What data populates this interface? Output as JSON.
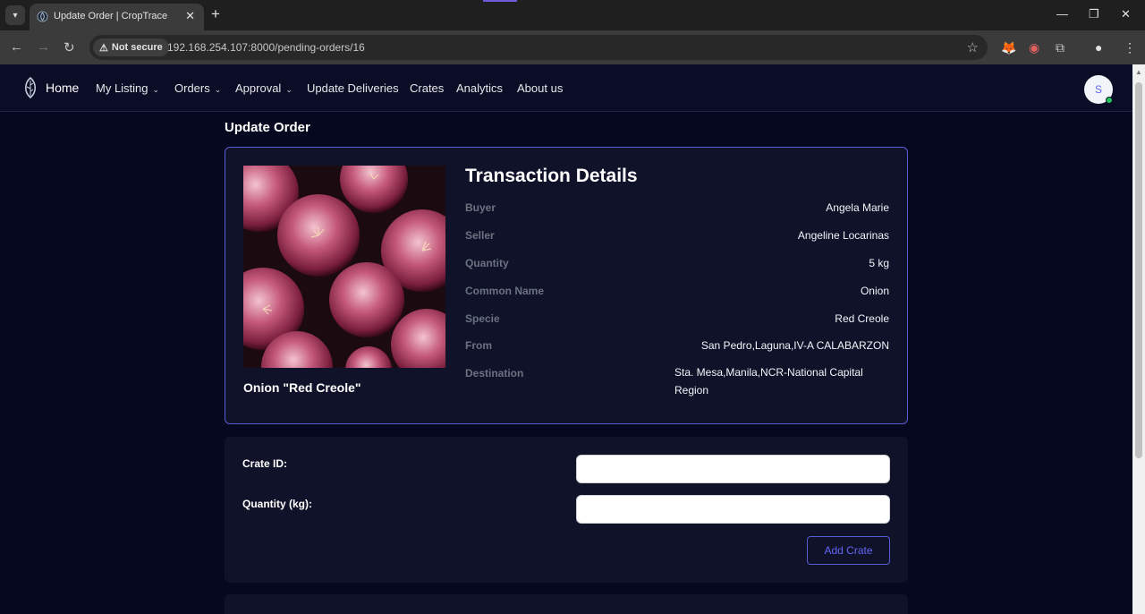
{
  "browser": {
    "tab_title": "Update Order | CropTrace",
    "tab_close": "✕",
    "new_tab": "+",
    "security_label": "Not secure",
    "url": "192.168.254.107:8000/pending-orders/16"
  },
  "nav": {
    "home": "Home",
    "items": [
      {
        "label": "My Listing",
        "dropdown": true
      },
      {
        "label": "Orders",
        "dropdown": true
      },
      {
        "label": "Approval",
        "dropdown": true
      },
      {
        "label": "Update Deliveries",
        "dropdown": false
      },
      {
        "label": "Crates",
        "dropdown": false
      },
      {
        "label": "Analytics",
        "dropdown": false
      },
      {
        "label": "About us",
        "dropdown": false
      }
    ],
    "avatar_initial": "S"
  },
  "page": {
    "title": "Update Order"
  },
  "transaction": {
    "heading": "Transaction Details",
    "product_name": "Onion \"Red Creole\"",
    "rows": [
      {
        "label": "Buyer",
        "value": "Angela Marie"
      },
      {
        "label": "Seller",
        "value": "Angeline Locarinas"
      },
      {
        "label": "Quantity",
        "value": "5 kg"
      },
      {
        "label": "Common Name",
        "value": "Onion"
      },
      {
        "label": "Specie",
        "value": "Red Creole"
      },
      {
        "label": "From",
        "value": "San Pedro,Laguna,IV-A CALABARZON"
      },
      {
        "label": "Destination",
        "value": "Sta. Mesa,Manila,NCR-National Capital Region"
      }
    ]
  },
  "form": {
    "crate_id_label": "Crate ID:",
    "crate_id_value": "",
    "quantity_label": "Quantity (kg):",
    "quantity_value": "",
    "add_button": "Add Crate"
  },
  "colors": {
    "accent": "#6366f1",
    "background": "#06081f",
    "card": "#0f1229"
  }
}
